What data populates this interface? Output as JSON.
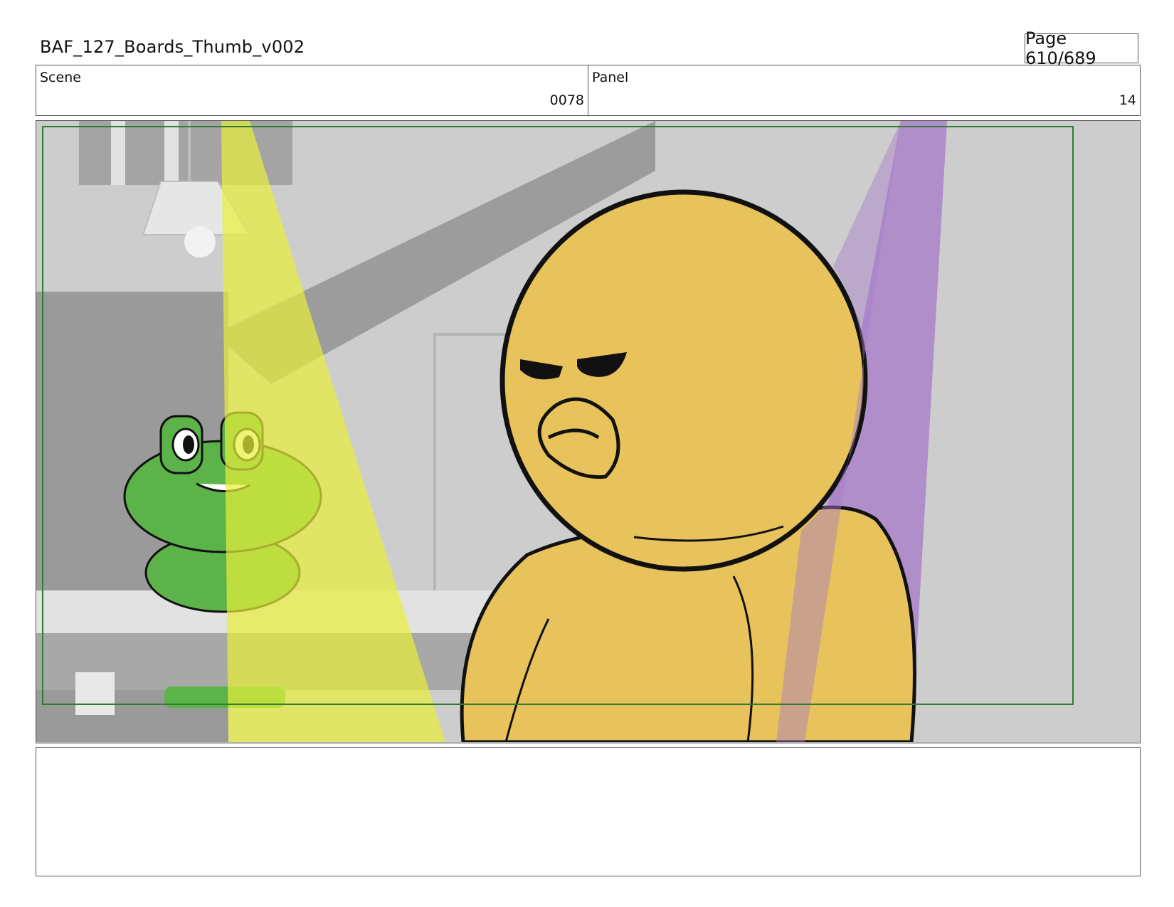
{
  "header": {
    "document_title": "BAF_127_Boards_Thumb_v002",
    "page_label": "Page 610/689"
  },
  "info": {
    "scene_label": "Scene",
    "scene_value": "0078",
    "panel_label": "Panel",
    "panel_value": "14"
  },
  "panel": {
    "safe_frame_color": "#2e7d32",
    "yellow_light_color": "#e8ef3a",
    "purple_light_color": "#a77cc9",
    "duck_color": "#e8c25a",
    "frog_color": "#5cb34a"
  },
  "notes": {
    "text": ""
  }
}
